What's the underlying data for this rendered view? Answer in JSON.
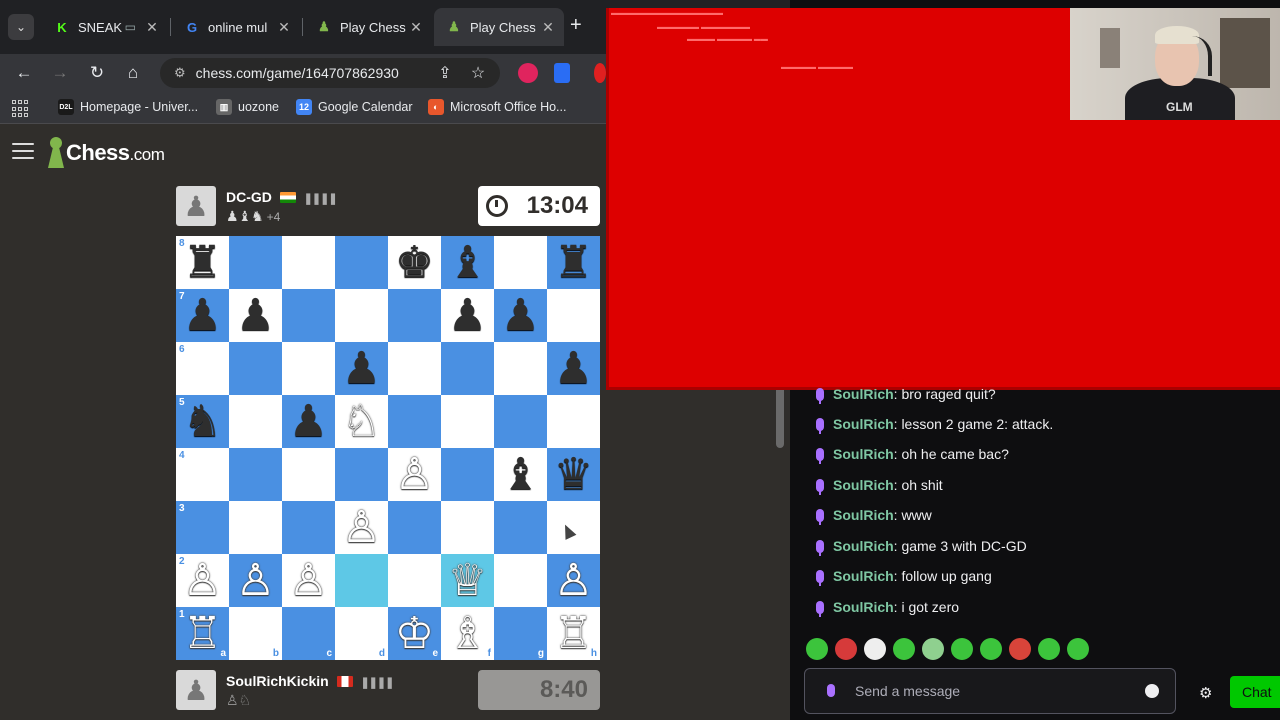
{
  "browser": {
    "tabs": [
      {
        "label": "SNEAK",
        "icon": "kick-icon",
        "color": "#53fc18",
        "extra": "▭",
        "active": false
      },
      {
        "label": "online mul",
        "icon": "google-icon",
        "color": "#ffffff",
        "active": false
      },
      {
        "label": "Play Chess",
        "icon": "chess-pawn-icon",
        "color": "#81b64c",
        "active": false
      },
      {
        "label": "Play Chess",
        "icon": "chess-pawn-icon",
        "color": "#81b64c",
        "active": true
      }
    ],
    "url": "chess.com/game/164707862930",
    "bookmarks": [
      {
        "label": "Homepage - Univer...",
        "badge": "D2L",
        "color": "#1a1a1a"
      },
      {
        "label": "uozone",
        "badge": "▥",
        "color": "#666666"
      },
      {
        "label": "Google Calendar",
        "badge": "12",
        "color": "#4285f4"
      },
      {
        "label": "Microsoft Office Ho...",
        "badge": "◐",
        "color": "#e8572c"
      }
    ]
  },
  "chess": {
    "logo": {
      "main": "Chess",
      "suffix": ".com"
    },
    "top_player": {
      "name": "DC-GD",
      "flag": "india",
      "bars": "❚❚❚❚",
      "captured": "♟♝♞",
      "advantage": "+4",
      "clock": "13:04",
      "clock_running": true
    },
    "bottom_player": {
      "name": "SoulRichKickin",
      "flag": "canada",
      "bars": "❚❚❚❚",
      "captured": "♙♘",
      "clock": "8:40",
      "clock_running": false
    },
    "board": [
      [
        "bR",
        "",
        "",
        "",
        "bK",
        "bB",
        "",
        "bR"
      ],
      [
        "bP",
        "bP",
        "",
        "",
        "",
        "bP",
        "bP",
        ""
      ],
      [
        "",
        "",
        "",
        "bP",
        "",
        "",
        "",
        "bP"
      ],
      [
        "bN",
        "",
        "bP",
        "wN",
        "",
        "",
        "",
        ""
      ],
      [
        "",
        "",
        "",
        "",
        "wP",
        "",
        "bB",
        "bQ"
      ],
      [
        "",
        "",
        "",
        "wP",
        "",
        "",
        "",
        ""
      ],
      [
        "wP",
        "wP",
        "wP",
        "",
        "",
        "wQ",
        "",
        "wP"
      ],
      [
        "wR",
        "",
        "",
        "",
        "wK",
        "wB",
        "",
        "wR"
      ]
    ],
    "highlighted": [
      "d2",
      "f2"
    ],
    "files": [
      "a",
      "b",
      "c",
      "d",
      "e",
      "f",
      "g",
      "h"
    ],
    "ranks": [
      "8",
      "7",
      "6",
      "5",
      "4",
      "3",
      "2",
      "1"
    ]
  },
  "chat": {
    "messages": [
      {
        "user": "SoulRich",
        "text": ": bro raged quit?"
      },
      {
        "user": "SoulRich",
        "text": ": lesson 2 game 2: attack."
      },
      {
        "user": "SoulRich",
        "text": ": oh he came bac?"
      },
      {
        "user": "SoulRich",
        "text": ": oh shit"
      },
      {
        "user": "SoulRich",
        "text": ": www"
      },
      {
        "user": "SoulRich",
        "text": ": game 3 with DC-GD"
      },
      {
        "user": "SoulRich",
        "text": ": follow up gang"
      },
      {
        "user": "SoulRich",
        "text": ": i got zero"
      }
    ],
    "emote_colors": [
      "#3cc43c",
      "#d63a3a",
      "#eeeeee",
      "#3cc43c",
      "#8fd08f",
      "#3cc43c",
      "#3cc43c",
      "#d8443a",
      "#3cc43c",
      "#3cc43c"
    ],
    "input_placeholder": "Send a message",
    "send_label": "Chat"
  },
  "webcam": {
    "shirt_text": "GLM"
  },
  "colors": {
    "overlay_red": "#dd0000",
    "board_dark": "#4a90e2",
    "board_light": "#ffffff",
    "accent_green": "#81b64c"
  }
}
